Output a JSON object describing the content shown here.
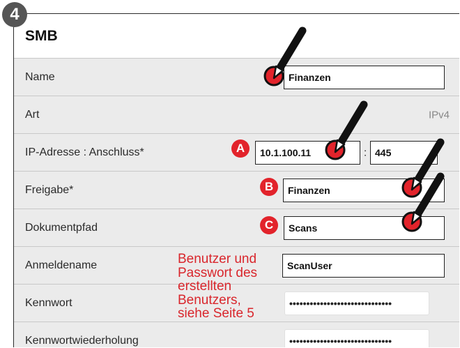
{
  "step_badge": "4",
  "panel": {
    "title": "SMB"
  },
  "rows": {
    "name": {
      "label": "Name",
      "value": "Finanzen"
    },
    "art": {
      "label": "Art",
      "value": "IPv4"
    },
    "ip": {
      "label": "IP-Adresse : Anschluss*",
      "ip_value": "10.1.100.11",
      "separator": ":",
      "port_value": "445"
    },
    "freigabe": {
      "label": "Freigabe*",
      "value": "Finanzen"
    },
    "dokumentpfad": {
      "label": "Dokumentpfad",
      "value": "Scans"
    },
    "anmeldename": {
      "label": "Anmeldename",
      "value": "ScanUser"
    },
    "kennwort": {
      "label": "Kennwort",
      "value": "••••••••••••••••••••••••••••••"
    },
    "kennwortwiederholung": {
      "label": "Kennwortwiederholung",
      "value": "••••••••••••••••••••••••••••••"
    }
  },
  "markers": {
    "a": "A",
    "b": "B",
    "c": "C"
  },
  "note_lines": [
    "Benutzer und",
    "Passwort des",
    "erstellten",
    "Benutzers,",
    "siehe Seite 5"
  ],
  "colors": {
    "accent_red": "#e2232b",
    "note_red": "#d9262c",
    "badge_gray": "#555555"
  },
  "icons": [
    "pen-icon"
  ]
}
